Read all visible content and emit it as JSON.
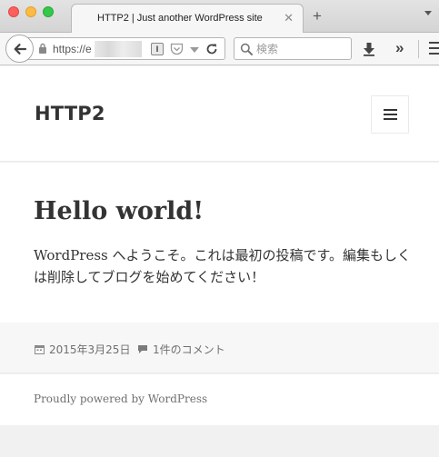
{
  "browser": {
    "tab_title": "HTTP2 | Just another WordPress site",
    "tab_close": "✕",
    "new_tab": "+",
    "url": "https://e",
    "search_placeholder": "検索",
    "overflow": "»",
    "reader_glyph": "I"
  },
  "site": {
    "title": "HTTP2"
  },
  "post": {
    "title": "Hello world!",
    "content": "WordPress へようこそ。これは最初の投稿です。編集もしくは削除してブログを始めてください！",
    "date": "2015年3月25日",
    "comments": "1件のコメント"
  },
  "footer": {
    "powered_by": "Proudly powered by WordPress"
  },
  "colors": {
    "text": "#333333",
    "meta": "#707070",
    "background": "#f1f1f1"
  }
}
